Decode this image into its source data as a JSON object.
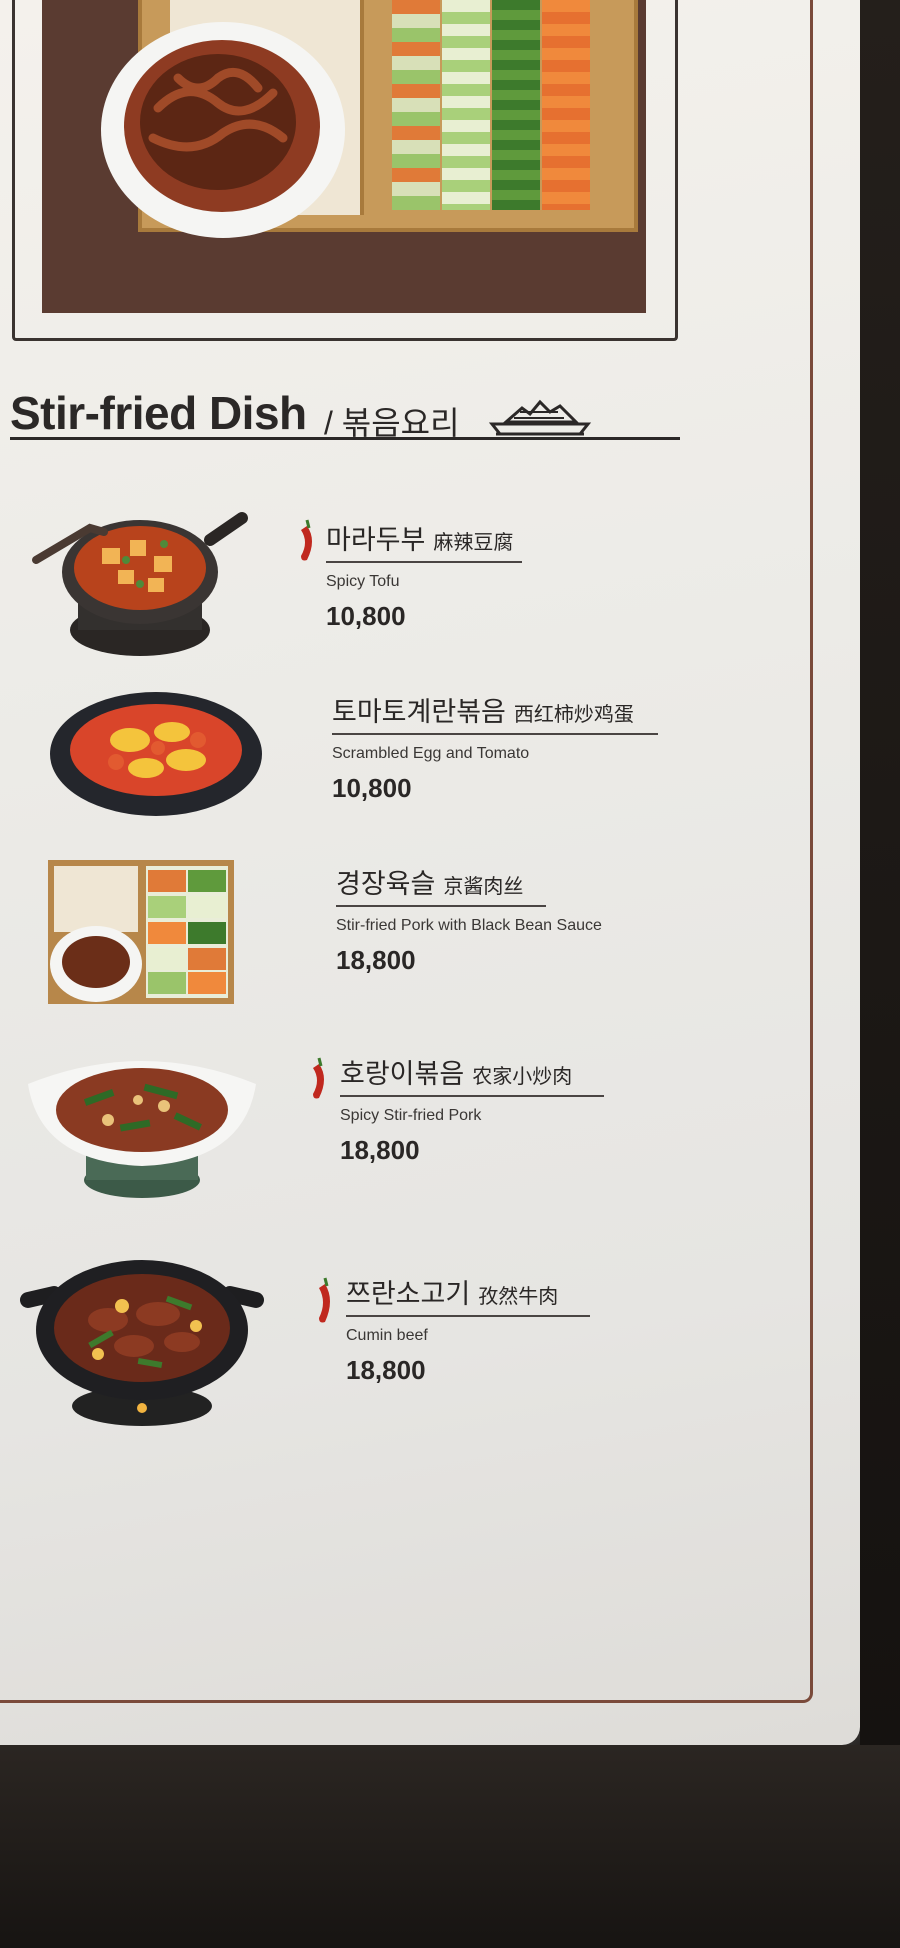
{
  "section": {
    "title": "Stir-fried Dish",
    "subtitle": "/ 볶음요리",
    "icon": "dish-cover-icon"
  },
  "items": [
    {
      "ko": "마라두부",
      "zh": "麻辣豆腐",
      "en": "Spicy Tofu",
      "price": "10,800",
      "spicy": true
    },
    {
      "ko": "토마토계란볶음",
      "zh": "西红柿炒鸡蛋",
      "en": "Scrambled Egg and Tomato",
      "price": "10,800",
      "spicy": false
    },
    {
      "ko": "경장육슬",
      "zh": "京酱肉丝",
      "en": "Stir-fried Pork with Black Bean Sauce",
      "price": "18,800",
      "spicy": false
    },
    {
      "ko": "호랑이볶음",
      "zh": "农家小炒肉",
      "en": "Spicy Stir-fried Pork",
      "price": "18,800",
      "spicy": true
    },
    {
      "ko": "쯔란소고기",
      "zh": "孜然牛肉",
      "en": "Cumin beef",
      "price": "18,800",
      "spicy": true
    }
  ],
  "colors": {
    "board": "#ecebe7",
    "frame": "#7a4a3a",
    "text": "#2a2726",
    "pepper": "#c0281e"
  }
}
